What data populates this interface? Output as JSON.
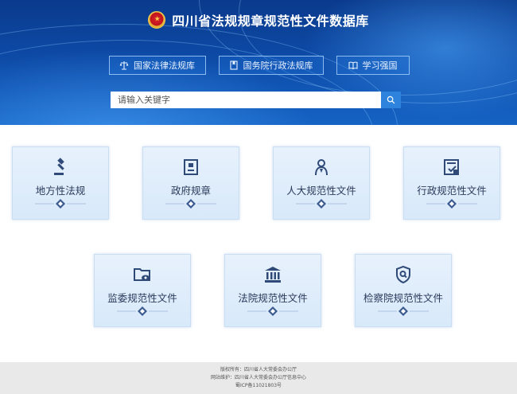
{
  "header": {
    "title": "四川省法规规章规范性文件数据库"
  },
  "nav": [
    {
      "label": "国家法律法规库",
      "icon": "scale-icon"
    },
    {
      "label": "国务院行政法规库",
      "icon": "bookmark-doc-icon"
    },
    {
      "label": "学习强国",
      "icon": "open-book-icon"
    }
  ],
  "search": {
    "placeholder": "请输入关键字",
    "button_icon": "search-icon"
  },
  "cards": [
    {
      "label": "地方性法规",
      "icon": "gavel-icon"
    },
    {
      "label": "政府规章",
      "icon": "id-document-icon"
    },
    {
      "label": "人大规范性文件",
      "icon": "person-icon"
    },
    {
      "label": "行政规范性文件",
      "icon": "approved-document-icon"
    },
    {
      "label": "监委规范性文件",
      "icon": "folder-eye-icon"
    },
    {
      "label": "法院规范性文件",
      "icon": "courthouse-icon"
    },
    {
      "label": "检察院规范性文件",
      "icon": "shield-search-icon"
    }
  ],
  "footer": {
    "copyright": "版权所有：四川省人大常委会办公厅",
    "maintainer": "网站维护：四川省人大常委会办公厅信息中心",
    "icp": "蜀ICP备11021803号"
  },
  "colors": {
    "banner": "#0d4aa6",
    "card_bg": "#e7f1fc",
    "icon": "#2f4a78",
    "search_button": "#2e84dd"
  }
}
